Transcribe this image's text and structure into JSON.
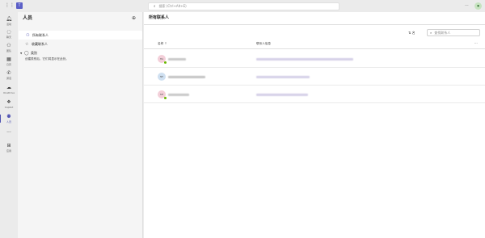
{
  "topbar": {
    "search_placeholder": "搜索 (Ctrl+Alt+E)",
    "more": "···"
  },
  "rail": [
    {
      "label": "活动",
      "icon": "bell-icon"
    },
    {
      "label": "聊天",
      "icon": "chat-icon"
    },
    {
      "label": "团队",
      "icon": "teams-icon"
    },
    {
      "label": "日历",
      "icon": "calendar-icon"
    },
    {
      "label": "通话",
      "icon": "phone-icon"
    },
    {
      "label": "OneDrive",
      "icon": "cloud-icon"
    },
    {
      "label": "Copilot",
      "icon": "copilot-icon"
    },
    {
      "label": "人员",
      "icon": "people-icon"
    },
    {
      "label": "···",
      "icon": "more-icon"
    },
    {
      "label": "应用",
      "icon": "apps-icon"
    }
  ],
  "left": {
    "title": "人员",
    "items": [
      {
        "label": "所有联系人"
      },
      {
        "label": "收藏联系人"
      }
    ],
    "section": "类别",
    "hint": "创建类别后，它们将显示在此处。"
  },
  "main": {
    "title": "所有联系人",
    "sort_label": "名",
    "search_placeholder": "查找联系人",
    "col_name": "名称",
    "col_sort": "↑",
    "col_email": "联系人信息",
    "more": "···",
    "contacts": [
      {
        "initials": "HA",
        "avatar_color": "#f3cfd9"
      },
      {
        "initials": "NP",
        "avatar_color": "#cfe0f1"
      },
      {
        "initials": "KZ",
        "avatar_color": "#f3cfd9"
      }
    ]
  }
}
